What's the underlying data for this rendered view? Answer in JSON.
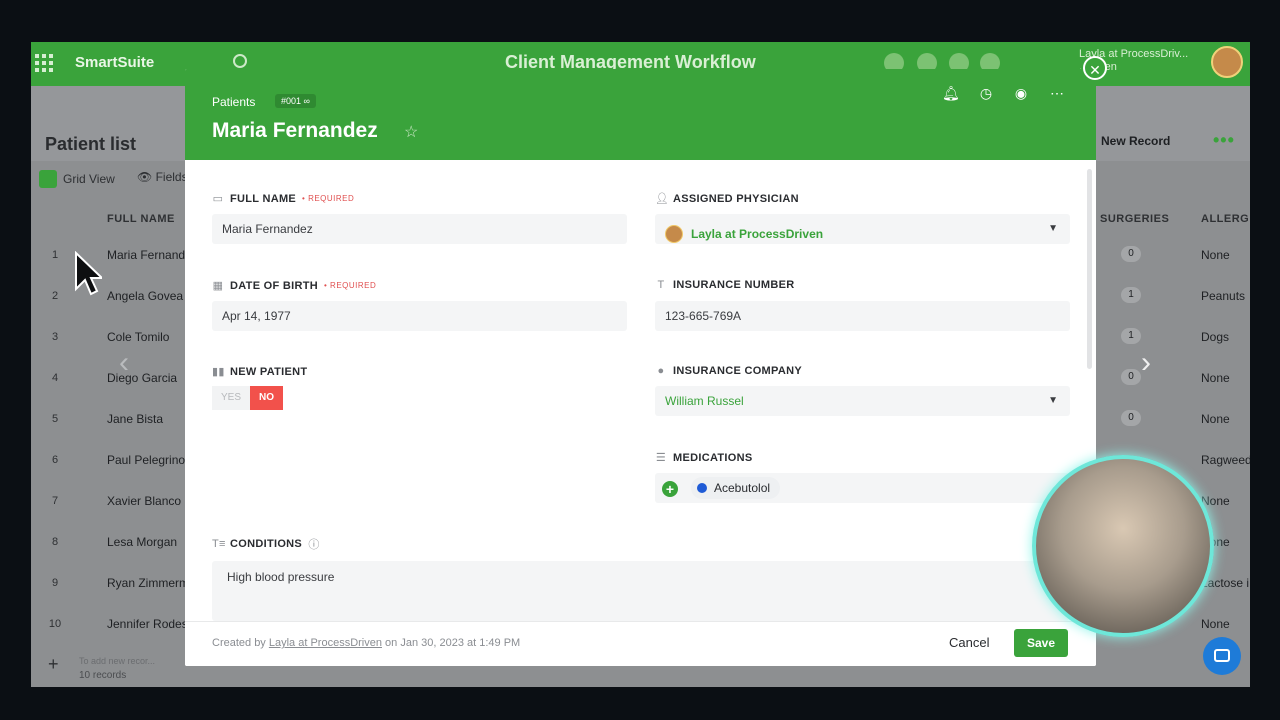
{
  "appbar": {
    "brand": "SmartSuite",
    "workflow_title": "Client Management Workflow",
    "user_line1": "Layla at ProcessDriv...",
    "user_line2": "..Driven"
  },
  "list": {
    "title": "Patient list",
    "view_label": "Grid View",
    "fields_label": "Fields",
    "new_record_label": "New Record",
    "columns": {
      "full_name": "FULL NAME",
      "surgeries": "SURGERIES",
      "allergies": "ALLERGI"
    },
    "rows": [
      {
        "num": "1",
        "name": "Maria Fernandez",
        "surgeries": "0",
        "allergy": "None"
      },
      {
        "num": "2",
        "name": "Angela Govea",
        "surgeries": "1",
        "allergy": "Peanuts"
      },
      {
        "num": "3",
        "name": "Cole Tomilo",
        "surgeries": "1",
        "allergy": "Dogs"
      },
      {
        "num": "4",
        "name": "Diego Garcia",
        "surgeries": "0",
        "allergy": "None"
      },
      {
        "num": "5",
        "name": "Jane Bista",
        "surgeries": "0",
        "allergy": "None"
      },
      {
        "num": "6",
        "name": "Paul Pelegrino",
        "surgeries": "",
        "allergy": "Ragweed"
      },
      {
        "num": "7",
        "name": "Xavier Blanco",
        "surgeries": "",
        "allergy": "None"
      },
      {
        "num": "8",
        "name": "Lesa Morgan",
        "surgeries": "",
        "allergy": "None"
      },
      {
        "num": "9",
        "name": "Ryan Zimmerman",
        "surgeries": "",
        "allergy": "Lactose i"
      },
      {
        "num": "10",
        "name": "Jennifer Rodes",
        "surgeries": "",
        "allergy": "None"
      }
    ],
    "add_hint": "To add new recor...",
    "records_count": "10 records"
  },
  "modal": {
    "breadcrumb": "Patients",
    "record_id": "#001",
    "title": "Maria Fernandez",
    "fields": {
      "full_name": {
        "label": "FULL NAME",
        "required": "• REQUIRED",
        "value": "Maria Fernandez"
      },
      "dob": {
        "label": "DATE OF BIRTH",
        "required": "• REQUIRED",
        "value": "Apr 14, 1977"
      },
      "new_patient": {
        "label": "NEW PATIENT",
        "yes": "YES",
        "no": "NO",
        "selected": "NO"
      },
      "physician": {
        "label": "ASSIGNED PHYSICIAN",
        "value": "Layla at ProcessDriven"
      },
      "insurance_number": {
        "label": "INSURANCE NUMBER",
        "value": "123-665-769A"
      },
      "insurance_company": {
        "label": "INSURANCE COMPANY",
        "value": "William Russel"
      },
      "medications": {
        "label": "MEDICATIONS",
        "items": [
          "Acebutolol"
        ]
      },
      "conditions": {
        "label": "CONDITIONS",
        "value": "High blood pressure"
      }
    },
    "footer": {
      "created_prefix": "Created by",
      "created_by": "Layla at ProcessDriven",
      "created_on": "on Jan 30, 2023 at 1:49 PM",
      "cancel": "Cancel",
      "save": "Save"
    }
  },
  "colors": {
    "brand_green": "#3aa33b",
    "no_red": "#f2514b",
    "med_blue": "#1f5bd6"
  },
  "icons": [
    "apps-grid-icon",
    "search-icon",
    "bell-icon",
    "clock-icon",
    "chat-icon",
    "more-icon",
    "star-icon",
    "close-icon",
    "chevron-down-icon",
    "link-icon"
  ]
}
